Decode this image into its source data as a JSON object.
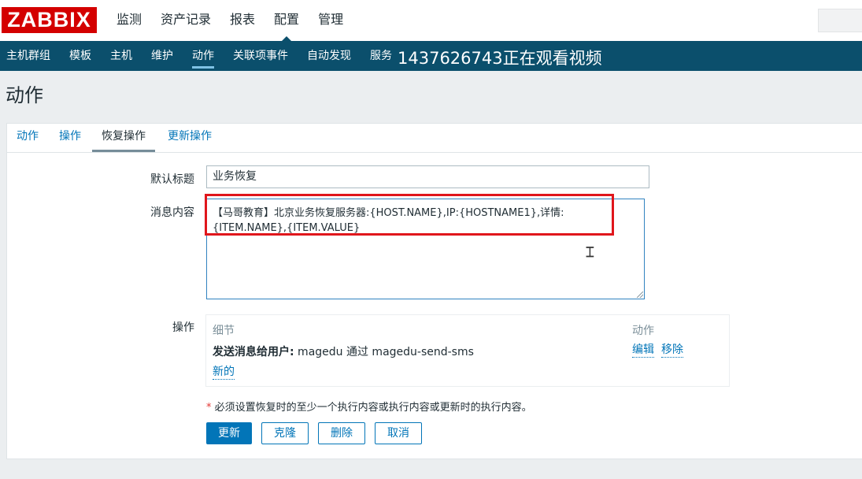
{
  "logo": "ZABBIX",
  "top_menu": [
    "监测",
    "资产记录",
    "报表",
    "配置",
    "管理"
  ],
  "sub_menu": [
    "主机群组",
    "模板",
    "主机",
    "维护",
    "动作",
    "关联项事件",
    "自动发现",
    "服务"
  ],
  "watermark": "1437626743正在观看视频",
  "page_title": "动作",
  "tabs": [
    "动作",
    "操作",
    "恢复操作",
    "更新操作"
  ],
  "form": {
    "default_subject_label": "默认标题",
    "default_subject_value": "业务恢复",
    "message_label": "消息内容",
    "message_line1": "【马哥教育】北京业务恢复服务器:{HOST.NAME},IP:{HOSTNAME1},详情:",
    "message_line2": "{ITEM.NAME},{ITEM.VALUE}",
    "operations_label": "操作"
  },
  "operations": {
    "col_details": "细节",
    "col_action": "动作",
    "row_bold": "发送消息给用户:",
    "row_rest": " magedu 通过 magedu-send-sms",
    "edit": "编辑",
    "remove": "移除",
    "new": "新的"
  },
  "note": {
    "star": "*",
    "text": " 必须设置恢复时的至少一个执行内容或执行内容或更新时的执行内容。"
  },
  "buttons": [
    "更新",
    "克隆",
    "删除",
    "取消"
  ],
  "colors": {
    "logo": "#d40000",
    "subnav": "#0b4f6c",
    "link": "#0275b8",
    "highlight": "#e0161c"
  }
}
